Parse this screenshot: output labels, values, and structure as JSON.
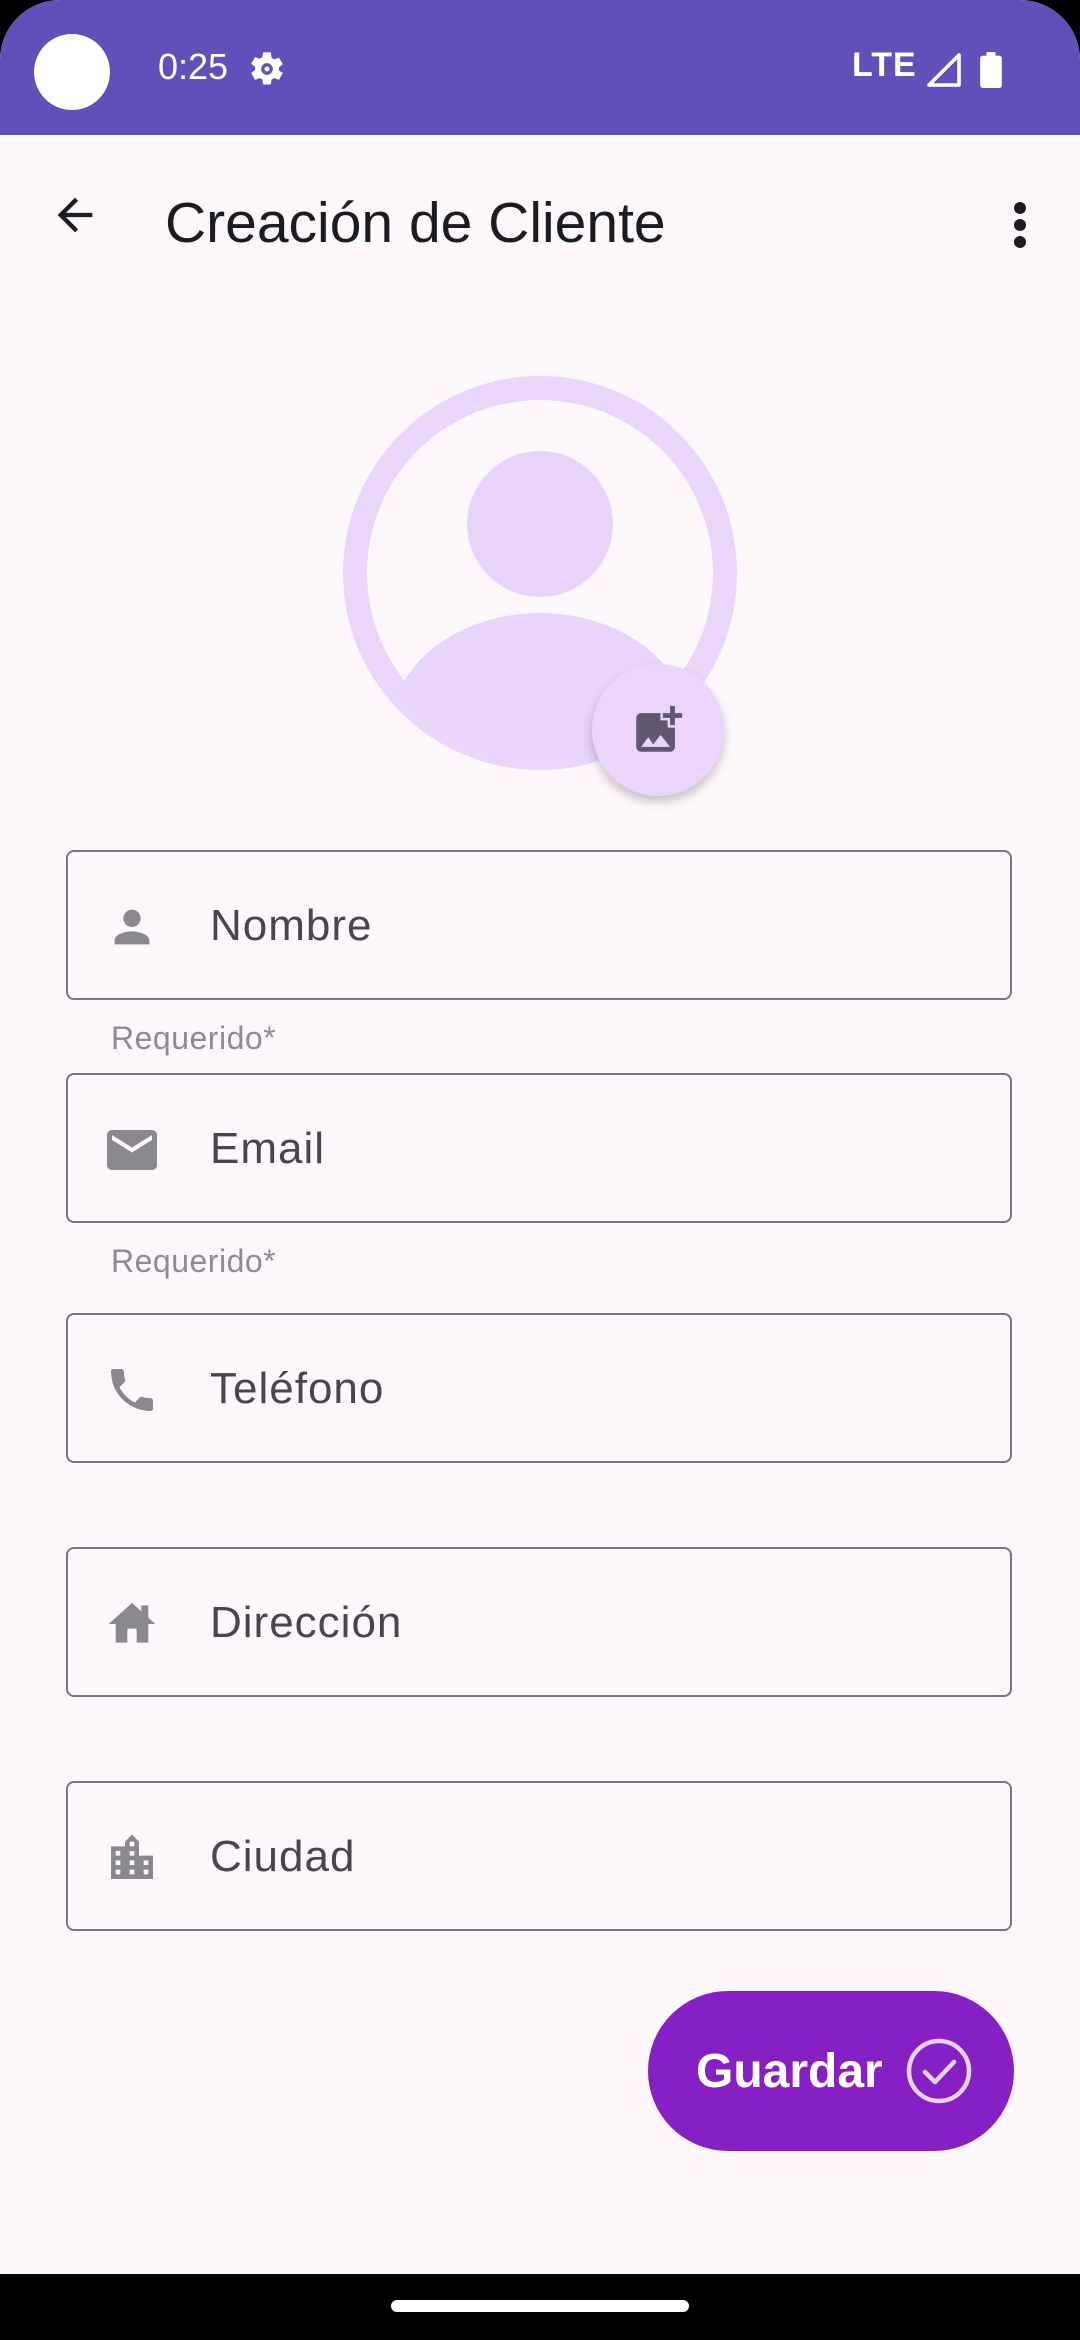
{
  "status_bar": {
    "time": "0:25",
    "network": "LTE",
    "icons": [
      "settings-gear-icon",
      "signal-icon",
      "battery-icon"
    ],
    "background_color": "#6150b9"
  },
  "app_bar": {
    "title": "Creación de Cliente",
    "back_icon": "arrow-back-icon",
    "menu_icon": "more-vert-icon"
  },
  "avatar": {
    "placeholder_icon": "person-placeholder-icon",
    "add_photo_icon": "add-photo-icon"
  },
  "form": {
    "fields": [
      {
        "icon": "person-icon",
        "placeholder": "Nombre",
        "helper": "Requerido*"
      },
      {
        "icon": "mail-icon",
        "placeholder": "Email",
        "helper": "Requerido*"
      },
      {
        "icon": "phone-icon",
        "placeholder": "Teléfono",
        "helper": ""
      },
      {
        "icon": "home-icon",
        "placeholder": "Dirección",
        "helper": ""
      },
      {
        "icon": "city-icon",
        "placeholder": "Ciudad",
        "helper": ""
      }
    ]
  },
  "save_button": {
    "label": "Guardar",
    "icon": "check-circle-icon",
    "color": "#861fc4"
  },
  "colors": {
    "background": "#fdf8fc",
    "avatar_tint": "#e8d4fb",
    "field_border": "#79747e"
  }
}
